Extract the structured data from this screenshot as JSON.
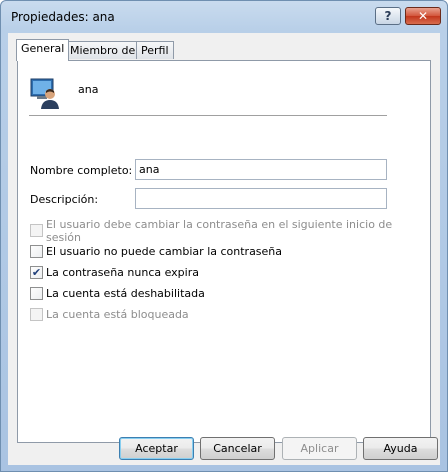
{
  "window": {
    "title": "Propiedades: ana",
    "help_button": "?",
    "close_button": "✕"
  },
  "tabs": [
    {
      "label": "General",
      "active": true
    },
    {
      "label": "Miembro de",
      "active": false
    },
    {
      "label": "Perfil",
      "active": false
    }
  ],
  "user": {
    "icon": "user-icon",
    "name": "ana"
  },
  "fields": {
    "full_name_label": "Nombre completo:",
    "full_name_value": "ana",
    "description_label": "Descripción:",
    "description_value": ""
  },
  "checkboxes": [
    {
      "label": "El usuario debe cambiar la contraseña en el siguiente inicio de sesión",
      "checked": false,
      "enabled": false
    },
    {
      "label": "El usuario no puede cambiar la contraseña",
      "checked": false,
      "enabled": true
    },
    {
      "label": "La contraseña nunca expira",
      "checked": true,
      "enabled": true
    },
    {
      "label": "La cuenta está deshabilitada",
      "checked": false,
      "enabled": true
    },
    {
      "label": "La cuenta está bloqueada",
      "checked": false,
      "enabled": false
    }
  ],
  "buttons": {
    "accept": "Aceptar",
    "cancel": "Cancelar",
    "apply": "Aplicar",
    "help": "Ayuda"
  },
  "colors": {
    "title_bar": "#b8cfe8",
    "close_button": "#c2361c",
    "default_button_border": "#3c7fb1"
  }
}
